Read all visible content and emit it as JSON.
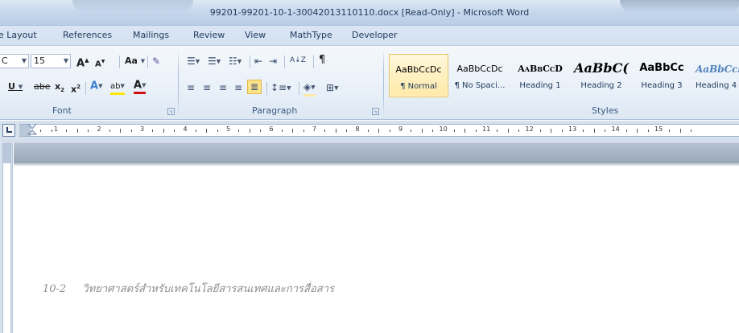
{
  "window": {
    "title": "99201-99201-10-1-30042013110110.docx [Read-Only]  -  Microsoft Word"
  },
  "tabs": [
    {
      "label": "e Layout"
    },
    {
      "label": "References"
    },
    {
      "label": "Mailings"
    },
    {
      "label": "Review"
    },
    {
      "label": "View"
    },
    {
      "label": "MathType"
    },
    {
      "label": "Developer"
    }
  ],
  "font_group": {
    "font_name_value": "C",
    "font_size_value": "15",
    "grow_font": "A",
    "shrink_font": "A",
    "change_case": "Aa",
    "underline": "U",
    "strikethrough": "abe",
    "subscript": "x",
    "superscript": "x",
    "text_effects": "A",
    "highlight": "ab",
    "font_color": "A",
    "label": "Font"
  },
  "paragraph_group": {
    "label": "Paragraph",
    "show_marks": "¶",
    "sort": "A↓Z"
  },
  "styles_group": {
    "label": "Styles",
    "items": [
      {
        "sample": "AaBbCcDc",
        "name": "¶ Normal"
      },
      {
        "sample": "AaBbCcDc",
        "name": "¶ No Spaci..."
      },
      {
        "sample": "AaBbCcD",
        "name": "Heading 1"
      },
      {
        "sample": "AaBbC(",
        "name": "Heading 2"
      },
      {
        "sample": "AaBbCc",
        "name": "Heading 3"
      },
      {
        "sample": "AaBbCcl",
        "name": "Heading 4"
      }
    ]
  },
  "ruler": {
    "numbers": [
      "1",
      "2",
      "3",
      "4",
      "5",
      "6",
      "7",
      "8",
      "9",
      "10",
      "11",
      "12",
      "13",
      "14",
      "15"
    ]
  },
  "document": {
    "page_number": "10-2",
    "header_text": "วิทยาศาสตร์สำหรับเทคโนโลยีสารสนเทศและการสื่อสาร"
  },
  "colors": {
    "title_text": "#1e395b",
    "selected_style": "#ffe9a8",
    "doc_text": "#8c8c8c"
  }
}
